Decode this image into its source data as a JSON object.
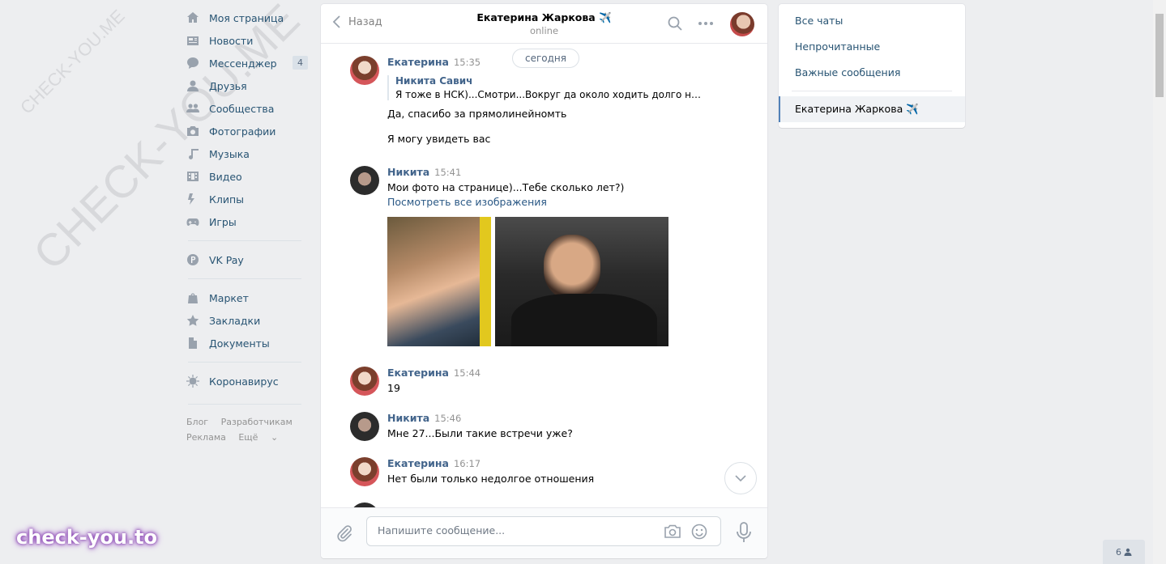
{
  "watermark": {
    "small": "CHECK-YOU.ME",
    "large": "CHECK-YOU.ME",
    "brand": "check-you.to"
  },
  "nav": {
    "items": [
      {
        "label": "Моя страница",
        "icon": "home-icon"
      },
      {
        "label": "Новости",
        "icon": "news-icon"
      },
      {
        "label": "Мессенджер",
        "icon": "messenger-icon",
        "badge": "4"
      },
      {
        "label": "Друзья",
        "icon": "friends-icon"
      },
      {
        "label": "Сообщества",
        "icon": "groups-icon"
      },
      {
        "label": "Фотографии",
        "icon": "camera-icon"
      },
      {
        "label": "Музыка",
        "icon": "music-icon"
      },
      {
        "label": "Видео",
        "icon": "video-icon"
      },
      {
        "label": "Клипы",
        "icon": "clips-icon"
      },
      {
        "label": "Игры",
        "icon": "gamepad-icon"
      }
    ],
    "pay": {
      "label": "VK Pay",
      "icon": "vkpay-icon"
    },
    "group3": [
      {
        "label": "Маркет",
        "icon": "bag-icon"
      },
      {
        "label": "Закладки",
        "icon": "star-icon"
      },
      {
        "label": "Документы",
        "icon": "document-icon"
      }
    ],
    "covid": {
      "label": "Коронавирус",
      "icon": "virus-icon"
    },
    "footer": {
      "blog": "Блог",
      "dev": "Разработчикам",
      "ads": "Реклама",
      "more": "Ещё"
    }
  },
  "chat": {
    "back_label": "Назад",
    "title": "Екатерина Жаркова ✈️",
    "status": "online",
    "date_pill": "сегодня",
    "messages": [
      {
        "author": "Екатерина",
        "time": "15:35",
        "quote": {
          "author": "Никита Савич",
          "text": "Я тоже в НСК)...Смотри...Вокруг да около ходить долго не б…"
        },
        "lines": [
          "Да, спасибо за прямолинейномть",
          "Я могу увидеть вас"
        ]
      },
      {
        "author": "Никита",
        "time": "15:41",
        "text": "Мои фото на странице)...Тебе сколько лет?)",
        "link": "Посмотреть все изображения"
      },
      {
        "author": "Екатерина",
        "time": "15:44",
        "text": "19"
      },
      {
        "author": "Никита",
        "time": "15:46",
        "text": "Мне 27...Были такие встречи уже?"
      },
      {
        "author": "Екатерина",
        "time": "16:17",
        "text": "Нет были только недолгое отношения"
      }
    ],
    "input_placeholder": "Напишите сообщение..."
  },
  "right_panel": {
    "items": [
      "Все чаты",
      "Непрочитанные",
      "Важные сообщения"
    ],
    "active_chat": "Екатерина Жаркова ✈️"
  },
  "online_count": "6"
}
